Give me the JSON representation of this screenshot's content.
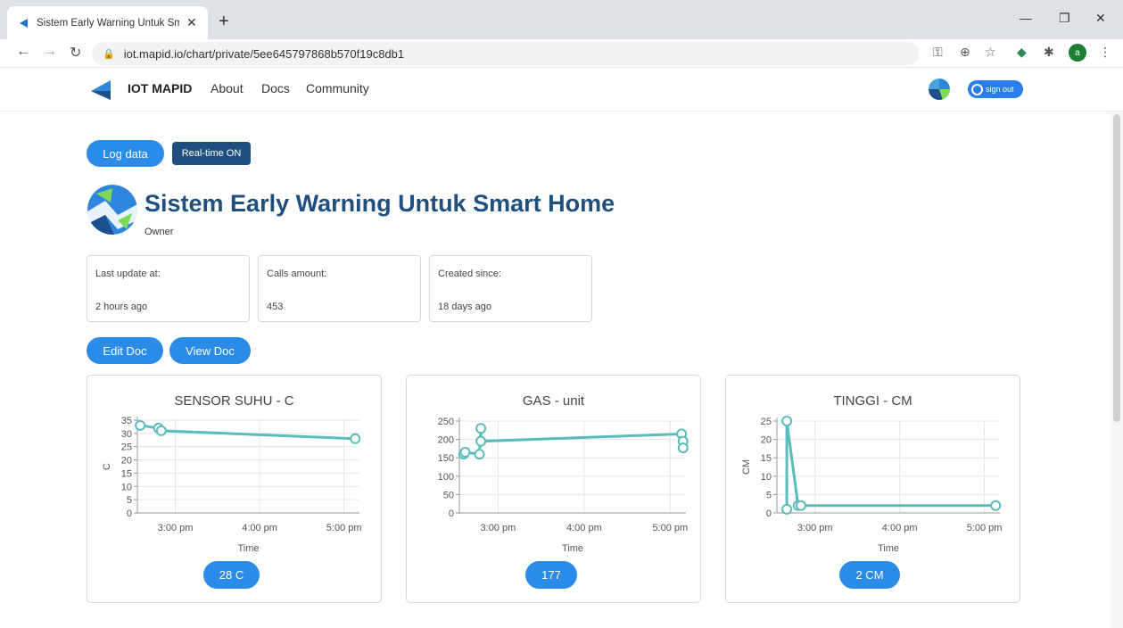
{
  "browser": {
    "tab_title": "Sistem Early Warning Untuk Sma",
    "url": "iot.mapid.io/chart/private/5ee645797868b570f19c8db1",
    "avatar_letter": "a"
  },
  "nav": {
    "brand": "IOT MAPID",
    "links": [
      "About",
      "Docs",
      "Community"
    ],
    "signout": "sign out"
  },
  "actions": {
    "log_data": "Log data",
    "realtime": "Real-time ON",
    "edit_doc": "Edit Doc",
    "view_doc": "View Doc"
  },
  "project": {
    "title": "Sistem Early Warning Untuk Smart Home",
    "role": "Owner"
  },
  "info": [
    {
      "label": "Last update at:",
      "value": "2 hours ago"
    },
    {
      "label": "Calls amount:",
      "value": "453"
    },
    {
      "label": "Created since:",
      "value": "18 days ago"
    }
  ],
  "colors": {
    "primary": "#2b8be8",
    "dark": "#1e4f7e",
    "line": "#5bbcbc"
  },
  "chart_data": [
    {
      "type": "line",
      "title": "SENSOR SUHU - C",
      "xlabel": "Time",
      "ylabel": "C",
      "x_ticks": [
        "3:00 pm",
        "4:00 pm",
        "5:00 pm"
      ],
      "y_ticks": [
        "0",
        "5",
        "10",
        "15",
        "20",
        "25",
        "30",
        "35"
      ],
      "ylim": [
        0,
        35
      ],
      "x": [
        "2:35 pm",
        "2:48 pm",
        "2:50 pm",
        "5:08 pm"
      ],
      "values": [
        33,
        32,
        31,
        28
      ],
      "current": "28 C"
    },
    {
      "type": "line",
      "title": "GAS - unit",
      "xlabel": "Time",
      "ylabel": "",
      "x_ticks": [
        "3:00 pm",
        "4:00 pm",
        "5:00 pm"
      ],
      "y_ticks": [
        "0",
        "50",
        "100",
        "150",
        "200",
        "250"
      ],
      "ylim": [
        0,
        250
      ],
      "x": [
        "2:36 pm",
        "2:37 pm",
        "2:47 pm",
        "2:48 pm",
        "2:48 pm",
        "5:08 pm",
        "5:09 pm",
        "5:09 pm"
      ],
      "values": [
        160,
        165,
        160,
        230,
        195,
        215,
        195,
        177
      ],
      "current": "177"
    },
    {
      "type": "line",
      "title": "TINGGI - CM",
      "xlabel": "Time",
      "ylabel": "CM",
      "x_ticks": [
        "3:00 pm",
        "4:00 pm",
        "5:00 pm"
      ],
      "y_ticks": [
        "0",
        "5",
        "10",
        "15",
        "20",
        "25"
      ],
      "ylim": [
        0,
        25
      ],
      "x": [
        "2:40 pm",
        "2:40 pm",
        "2:48 pm",
        "2:50 pm",
        "5:08 pm"
      ],
      "values": [
        1,
        25,
        2,
        2,
        2
      ],
      "current": "2 CM"
    }
  ]
}
